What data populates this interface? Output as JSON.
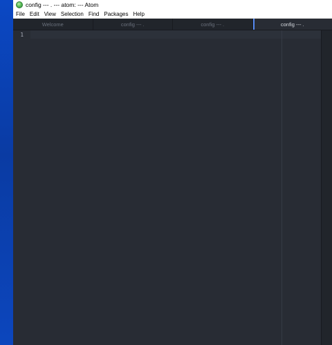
{
  "window": {
    "title": "config --- . --- atom: --- Atom",
    "icon": "atom-icon"
  },
  "menubar": {
    "items": [
      {
        "label": "File"
      },
      {
        "label": "Edit"
      },
      {
        "label": "View"
      },
      {
        "label": "Selection"
      },
      {
        "label": "Find"
      },
      {
        "label": "Packages"
      },
      {
        "label": "Help"
      }
    ]
  },
  "tabs": [
    {
      "label": "Welcome",
      "active": false
    },
    {
      "label": "config --- .",
      "active": false
    },
    {
      "label": "config --- .",
      "active": false
    },
    {
      "label": "config --- .",
      "active": true
    }
  ],
  "editor": {
    "line_numbers": [
      "1"
    ]
  },
  "colors": {
    "editor_background": "#282c34",
    "active_tab_accent": "#568af2",
    "desktop_blue": "#0a3ea8"
  }
}
